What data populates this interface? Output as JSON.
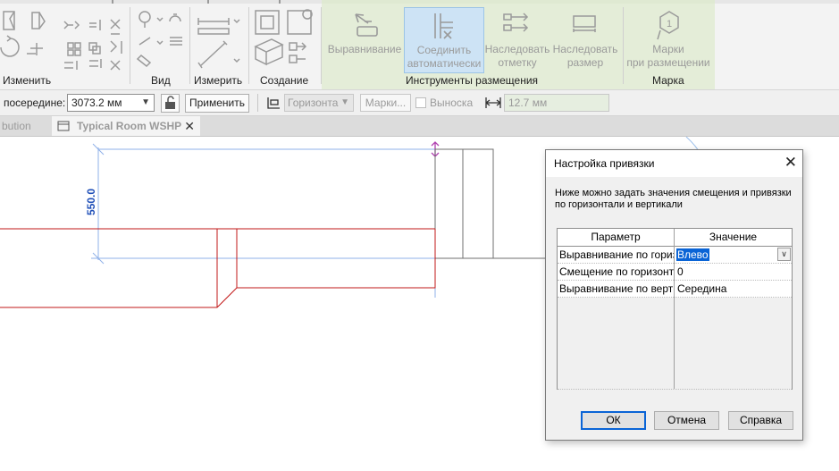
{
  "ribbon": {
    "panels": {
      "modify": "Изменить",
      "view": "Вид",
      "measure": "Измерить",
      "create": "Создание",
      "placement_tools": "Инструменты размещения",
      "tag": "Марка"
    },
    "buttons": {
      "align": "Выравнивание",
      "auto_connect_1": "Соединить",
      "auto_connect_2": "автоматически",
      "inherit_elev_1": "Наследовать",
      "inherit_elev_2": "отметку",
      "inherit_size_1": "Наследовать",
      "inherit_size_2": "размер",
      "tag_placement_1": "Марки",
      "tag_placement_2": "при размещении"
    }
  },
  "options_bar": {
    "offset_label": "посередине:",
    "offset_value": "3073.2 мм",
    "apply_label": "Применить",
    "orientation_value": "Горизонта",
    "tags_label": "Марки...",
    "leader_label": "Выноска",
    "leader_length": "12.7 мм"
  },
  "tabs": [
    {
      "label": "bution"
    },
    {
      "label": "Typical Room WSHP"
    }
  ],
  "canvas": {
    "dimension_text": "550.0"
  },
  "dialog": {
    "title": "Настройка привязки",
    "description": "Ниже можно задать значения смещения и привязки по горизонтали и вертикали",
    "col_param": "Параметр",
    "col_value": "Значение",
    "rows": [
      {
        "param": "Выравнивание по горизонтали",
        "value": "Влево"
      },
      {
        "param": "Смещение по горизонтали",
        "value": "0"
      },
      {
        "param": "Выравнивание по вертикали",
        "value": "Середина"
      }
    ],
    "ok": "ОК",
    "cancel": "Отмена",
    "help": "Справка"
  },
  "colors": {
    "context_tab": "#e4edd8",
    "active_button": "#cde3f5",
    "dimension_line": "#8fb0e8",
    "dimension_text": "#1f4fb8",
    "duct_red": "#c21818",
    "selection": "#0a64d6"
  }
}
